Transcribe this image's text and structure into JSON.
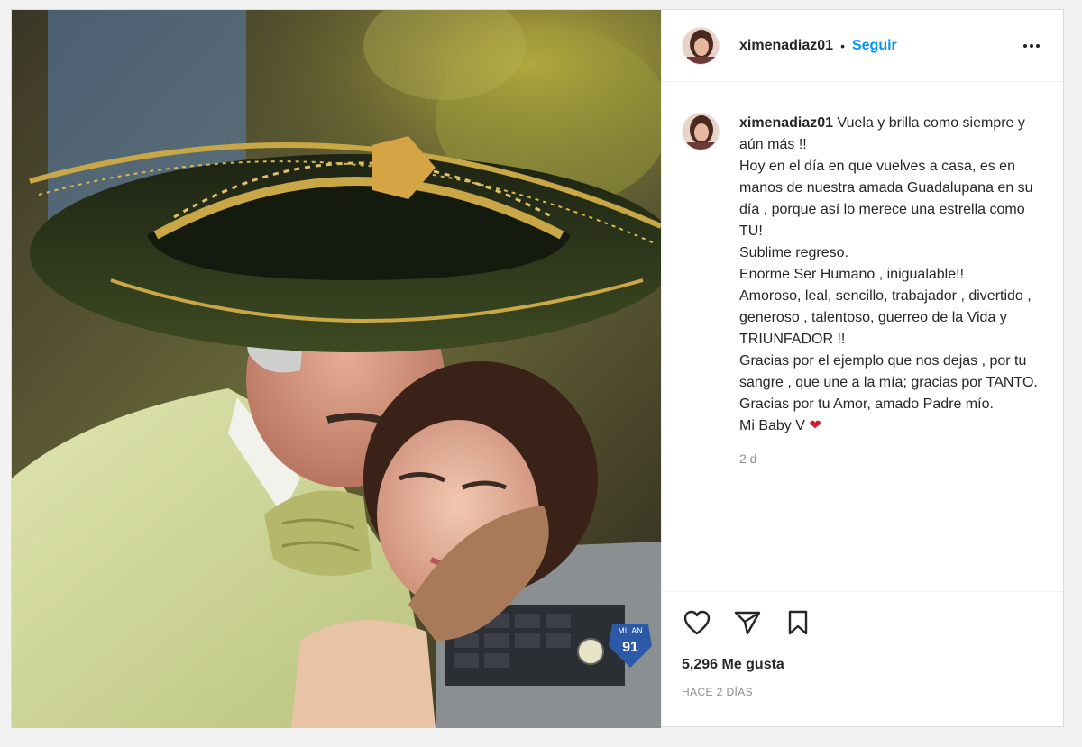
{
  "post": {
    "username": "ximenadiaz01",
    "separator": "•",
    "follow_label": "Seguir",
    "caption": {
      "username": "ximenadiaz01",
      "lines": [
        "Vuela y brilla como siempre y aún más !!",
        "Hoy en el día en que vuelves a casa, es en manos de nuestra amada Guadalupana en su día , porque así lo merece una estrella como TU!",
        "Sublime regreso.",
        "Enorme Ser Humano , inigualable!!",
        "Amoroso, leal, sencillo, trabajador , divertido , generoso , talentoso, guerreo de la Vida y TRIUNFADOR !!",
        "Gracias por el ejemplo que nos dejas , por tu sangre , que une a la mía; gracias por TANTO.",
        "Gracias por tu Amor, amado Padre mío.",
        "Mi Baby V"
      ],
      "emoji": "❤"
    },
    "caption_age": "2 d",
    "likes": "5,296 Me gusta",
    "posted_ago": "HACE 2 DÍAS",
    "photo_sticker_text": "MILAN",
    "photo_sticker_number": "91",
    "icons": {
      "more": "more-options-icon",
      "like": "heart-icon",
      "share": "send-icon",
      "save": "bookmark-icon"
    },
    "colors": {
      "accent": "#0095f6",
      "text": "#262626",
      "muted": "#8e8e8e",
      "heart": "#d0172b"
    }
  }
}
